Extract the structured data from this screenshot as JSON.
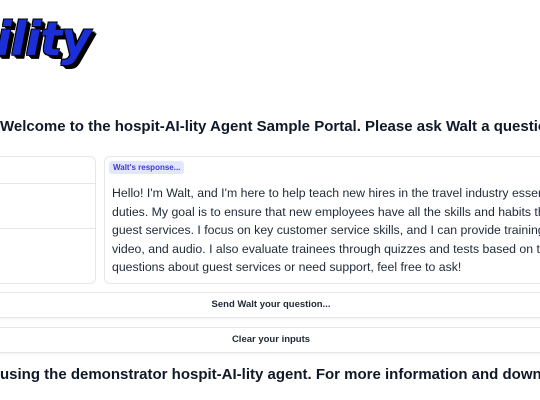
{
  "header": {
    "logo_text": "ility"
  },
  "welcome": {
    "text": "Welcome to the hospit-AI-lity Agent Sample Portal. Please ask Walt a question..."
  },
  "response": {
    "label": "Walt's response...",
    "lines": [
      "Hello! I'm Walt, and I'm here to help teach new hires in the travel industry essen",
      "duties. My goal is to ensure that new employees have all the skills and habits th",
      "guest services. I focus on key customer service skills, and I can provide training",
      "video, and audio. I also evaluate trainees through quizzes and tests based on th",
      "questions about guest services or need support, feel free to ask!"
    ]
  },
  "buttons": {
    "send_label": "Send Walt your question...",
    "clear_label": "Clear your inputs"
  },
  "footer": {
    "text": "using the demonstrator hospit-AI-lity agent. For more information and downloads, visi"
  }
}
